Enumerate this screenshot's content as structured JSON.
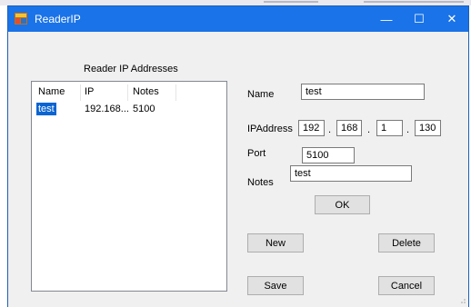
{
  "window": {
    "title": "ReaderIP",
    "controls": {
      "minimize": "—",
      "maximize": "☐",
      "close": "✕"
    }
  },
  "list": {
    "heading": "Reader IP Addresses",
    "columns": [
      "Name",
      "IP",
      "Notes"
    ],
    "rows": [
      {
        "name": "test",
        "ip": "192.168...",
        "notes": "5100"
      }
    ]
  },
  "form": {
    "name_label": "Name",
    "name_value": "test",
    "ip_label": "IPAddress",
    "ip_octets": [
      "192",
      "168",
      "1",
      "130"
    ],
    "ip_separator": ".",
    "port_label": "Port",
    "port_value": "5100",
    "notes_label": "Notes",
    "notes_value": "test",
    "ok_label": "OK"
  },
  "actions": {
    "new_label": "New",
    "delete_label": "Delete",
    "save_label": "Save",
    "cancel_label": "Cancel"
  },
  "colors": {
    "titlebar": "#1a73e8",
    "selection": "#0a64d2",
    "window_bg": "#f0f0f0"
  }
}
